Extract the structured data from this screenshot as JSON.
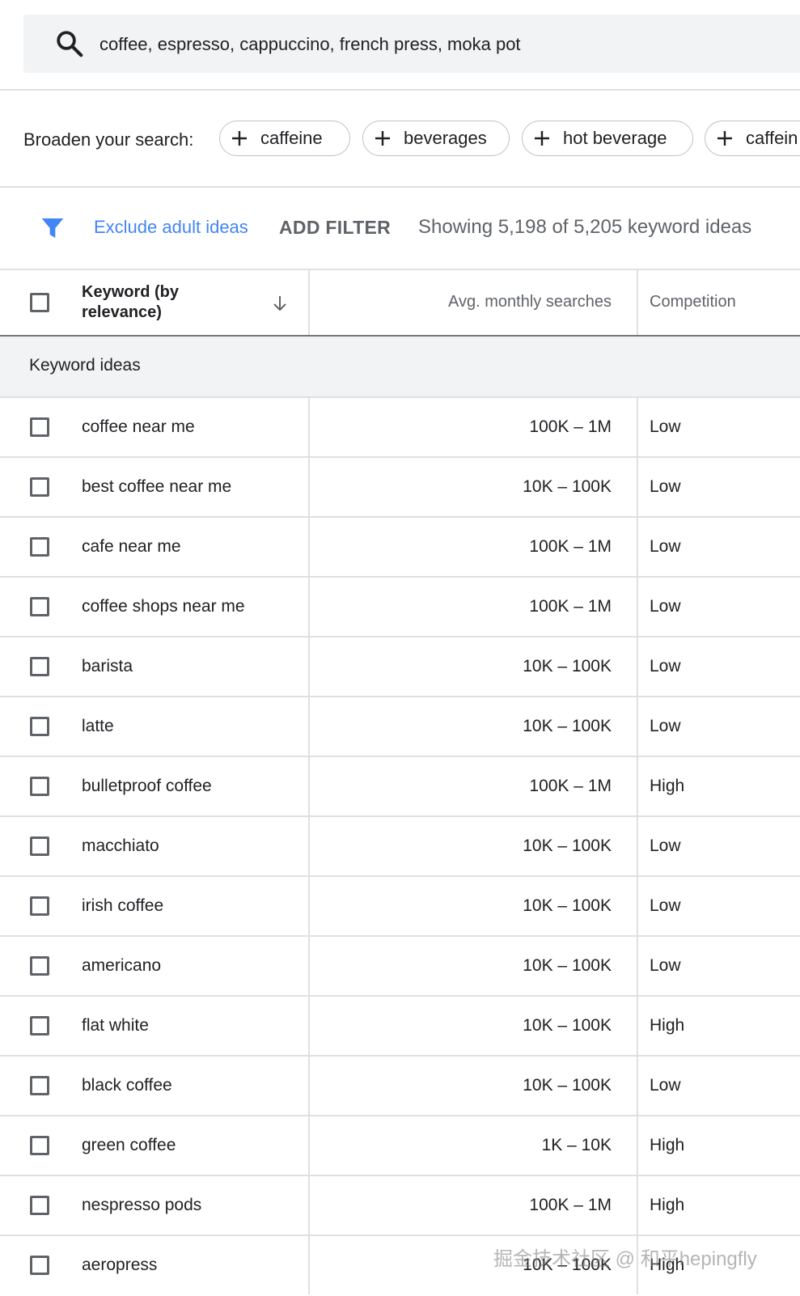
{
  "search": {
    "query": "coffee, espresso, cappuccino, french press, moka pot",
    "icon": "search-icon"
  },
  "broaden": {
    "label": "Broaden your search:",
    "chips": [
      "caffeine",
      "beverages",
      "hot beverage",
      "caffein"
    ]
  },
  "filters": {
    "exclude_label": "Exclude adult ideas",
    "add_filter_label": "ADD FILTER",
    "showing_text": "Showing 5,198 of 5,205 keyword ideas",
    "accent_color": "#4285f4"
  },
  "table": {
    "headers": {
      "keyword": "Keyword (by relevance)",
      "searches": "Avg. monthly searches",
      "competition": "Competition"
    },
    "group_label": "Keyword ideas",
    "rows": [
      {
        "keyword": "coffee near me",
        "searches": "100K – 1M",
        "competition": "Low"
      },
      {
        "keyword": "best coffee near me",
        "searches": "10K – 100K",
        "competition": "Low"
      },
      {
        "keyword": "cafe near me",
        "searches": "100K – 1M",
        "competition": "Low"
      },
      {
        "keyword": "coffee shops near me",
        "searches": "100K – 1M",
        "competition": "Low"
      },
      {
        "keyword": "barista",
        "searches": "10K – 100K",
        "competition": "Low"
      },
      {
        "keyword": "latte",
        "searches": "10K – 100K",
        "competition": "Low"
      },
      {
        "keyword": "bulletproof coffee",
        "searches": "100K – 1M",
        "competition": "High"
      },
      {
        "keyword": "macchiato",
        "searches": "10K – 100K",
        "competition": "Low"
      },
      {
        "keyword": "irish coffee",
        "searches": "10K – 100K",
        "competition": "Low"
      },
      {
        "keyword": "americano",
        "searches": "10K – 100K",
        "competition": "Low"
      },
      {
        "keyword": "flat white",
        "searches": "10K – 100K",
        "competition": "High"
      },
      {
        "keyword": "black coffee",
        "searches": "10K – 100K",
        "competition": "Low"
      },
      {
        "keyword": "green coffee",
        "searches": "1K – 10K",
        "competition": "High"
      },
      {
        "keyword": "nespresso pods",
        "searches": "100K – 1M",
        "competition": "High"
      },
      {
        "keyword": "aeropress",
        "searches": "10K – 100K",
        "competition": "High"
      }
    ]
  },
  "watermark": "掘金技术社区 @ 和平hepingfly"
}
